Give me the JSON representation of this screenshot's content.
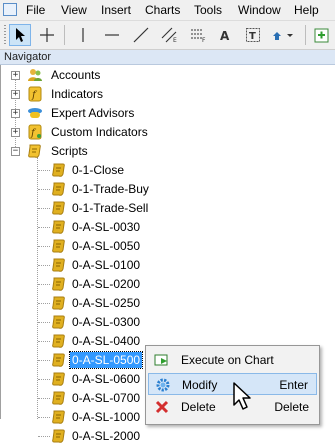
{
  "menubar": {
    "items": [
      "File",
      "View",
      "Insert",
      "Charts",
      "Tools",
      "Window",
      "Help"
    ]
  },
  "toolbar": {
    "tools": [
      "cursor-tool",
      "crosshair-tool",
      "vertical-line-tool",
      "horizontal-line-tool",
      "trendline-tool",
      "equidistant-channel-tool",
      "fibonacci-retracement-tool",
      "text-tool",
      "text-label-tool",
      "arrows-tool",
      "new-chart-tool"
    ],
    "active_tool": "cursor-tool"
  },
  "navigator": {
    "title": "Navigator",
    "top_items": [
      {
        "label": "Accounts",
        "icon": "accounts-icon"
      },
      {
        "label": "Indicators",
        "icon": "indicators-icon"
      },
      {
        "label": "Expert Advisors",
        "icon": "expert-advisors-icon"
      },
      {
        "label": "Custom Indicators",
        "icon": "custom-indicators-icon"
      },
      {
        "label": "Scripts",
        "icon": "scripts-icon"
      }
    ],
    "scripts": [
      "0-1-Close",
      "0-1-Trade-Buy",
      "0-1-Trade-Sell",
      "0-A-SL-0030",
      "0-A-SL-0050",
      "0-A-SL-0100",
      "0-A-SL-0200",
      "0-A-SL-0250",
      "0-A-SL-0300",
      "0-A-SL-0400",
      "0-A-SL-0500",
      "0-A-SL-0600",
      "0-A-SL-0700",
      "0-A-SL-1000",
      "0-A-SL-2000"
    ],
    "selected_script": "0-A-SL-0500"
  },
  "context_menu": {
    "items": [
      {
        "label": "Execute on Chart",
        "shortcut": "",
        "icon": "execute-on-chart-icon"
      },
      {
        "label": "Modify",
        "shortcut": "Enter",
        "icon": "modify-gear-icon"
      },
      {
        "label": "Delete",
        "shortcut": "Delete",
        "icon": "delete-x-icon"
      }
    ],
    "hovered": "Modify"
  },
  "colors": {
    "selection": "#3399ff",
    "menu_hover": "#d5e6f8",
    "header": "#dce7f5",
    "script_icon": "#e0b020"
  }
}
